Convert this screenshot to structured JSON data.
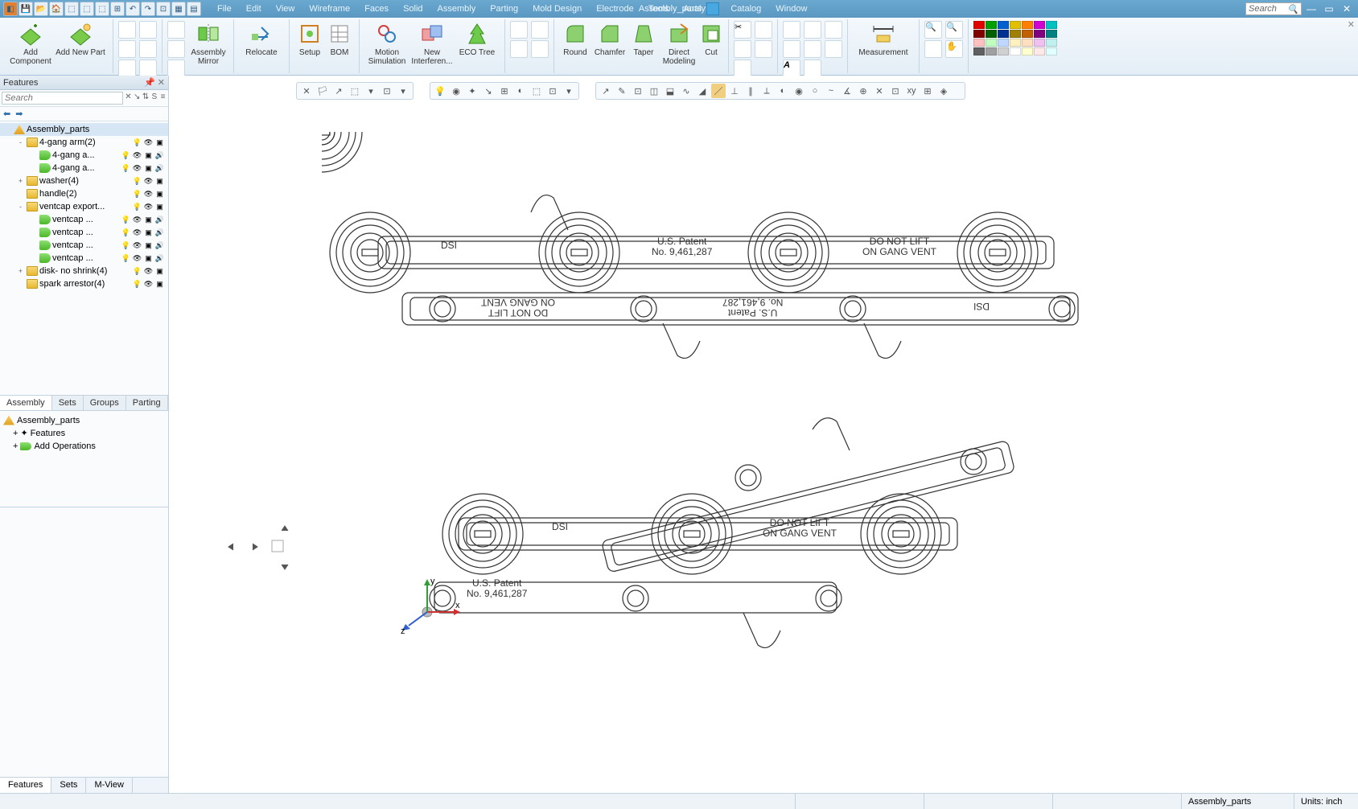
{
  "app": {
    "title": "Assembly_parts"
  },
  "menus": [
    "File",
    "Edit",
    "View",
    "Wireframe",
    "Faces",
    "Solid",
    "Assembly",
    "Parting",
    "Mold Design",
    "Electrode",
    "Tools",
    "Analysis",
    "Catalog",
    "Window"
  ],
  "search_placeholder": "Search",
  "ribbon": {
    "add_component": "Add\nComponent",
    "add_new_part": "Add New Part",
    "assembly_mirror": "Assembly\nMirror",
    "relocate": "Relocate",
    "setup": "Setup",
    "bom": "BOM",
    "motion_sim": "Motion\nSimulation",
    "new_interferen": "New\nInterferen...",
    "eco_tree": "ECO Tree",
    "round": "Round",
    "chamfer": "Chamfer",
    "taper": "Taper",
    "direct_modeling": "Direct\nModeling",
    "cut": "Cut",
    "measurement": "Measurement"
  },
  "panel": {
    "title": "Features",
    "search_placeholder": "Search",
    "tree": [
      {
        "d": 0,
        "exp": "",
        "ico": "asm",
        "label": "Assembly_parts",
        "sel": true
      },
      {
        "d": 1,
        "exp": "-",
        "ico": "folder",
        "label": "4-gang arm(2)",
        "badges": [
          "bulb",
          "eye",
          "box"
        ]
      },
      {
        "d": 2,
        "exp": "",
        "ico": "part",
        "label": "4-gang a...",
        "badges": [
          "bulb",
          "eye",
          "box",
          "spk"
        ]
      },
      {
        "d": 2,
        "exp": "",
        "ico": "part",
        "label": "4-gang a...",
        "badges": [
          "bulb",
          "eye",
          "box",
          "spk"
        ]
      },
      {
        "d": 1,
        "exp": "+",
        "ico": "folder",
        "label": "washer(4)",
        "badges": [
          "bulb",
          "eye",
          "box"
        ]
      },
      {
        "d": 1,
        "exp": "",
        "ico": "folder",
        "label": "handle(2)",
        "badges": [
          "bulb",
          "eye",
          "box"
        ]
      },
      {
        "d": 1,
        "exp": "-",
        "ico": "folder",
        "label": "ventcap export...",
        "badges": [
          "bulb",
          "eye",
          "box"
        ]
      },
      {
        "d": 2,
        "exp": "",
        "ico": "part",
        "label": "ventcap ...",
        "badges": [
          "bulb",
          "eye",
          "box",
          "spk"
        ]
      },
      {
        "d": 2,
        "exp": "",
        "ico": "part",
        "label": "ventcap ...",
        "badges": [
          "bulb",
          "eye",
          "box",
          "spk"
        ]
      },
      {
        "d": 2,
        "exp": "",
        "ico": "part",
        "label": "ventcap ...",
        "badges": [
          "bulb",
          "eye",
          "box",
          "spk"
        ]
      },
      {
        "d": 2,
        "exp": "",
        "ico": "part",
        "label": "ventcap ...",
        "badges": [
          "bulb",
          "eye",
          "box",
          "spk"
        ]
      },
      {
        "d": 1,
        "exp": "+",
        "ico": "folder",
        "label": "disk- no shrink(4)",
        "badges": [
          "bulb",
          "eye",
          "box"
        ]
      },
      {
        "d": 1,
        "exp": "",
        "ico": "folder",
        "label": "spark arrestor(4)",
        "badges": [
          "bulb",
          "eye",
          "box"
        ]
      }
    ],
    "mid_tabs": [
      "Assembly",
      "Sets",
      "Groups",
      "Parting"
    ],
    "ops": {
      "root": "Assembly_parts",
      "features": "Features",
      "add_ops": "Add Operations"
    },
    "bottom_tabs": [
      "Features",
      "Sets",
      "M-View"
    ]
  },
  "status": {
    "doc": "Assembly_parts",
    "units": "Units: inch"
  },
  "drawing_text": {
    "dsi": "DSI",
    "patent": "U.S. Patent\nNo. 9,461,287",
    "warn": "DO NOT LIFT\nON GANG VENT"
  },
  "triad": {
    "x": "x",
    "y": "y",
    "z": "z"
  },
  "colors": {
    "palette": [
      "#e00000",
      "#00a000",
      "#0060d0",
      "#e0c000",
      "#ff8000",
      "#d000d0",
      "#00c0c0",
      "#800000",
      "#006000",
      "#003090",
      "#a08000",
      "#c06000",
      "#800080",
      "#008080",
      "#ffc0c0",
      "#c0ffc0",
      "#c0d8ff",
      "#fff0c0",
      "#ffe0c0",
      "#f0c0f0",
      "#c0f0f0",
      "#606060",
      "#a0a0a0",
      "#d0d0d0",
      "#ffffff",
      "#ffffd0",
      "#ffe8e8",
      "#e0ffff"
    ]
  }
}
